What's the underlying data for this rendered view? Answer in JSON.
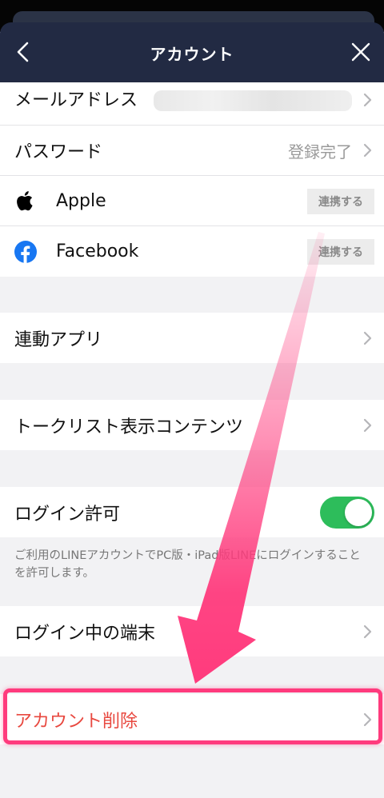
{
  "header": {
    "title": "アカウント"
  },
  "account": {
    "email_label": "メールアドレス",
    "password_label": "パスワード",
    "password_value": "登録完了",
    "apple_label": "Apple",
    "apple_button": "連携する",
    "facebook_label": "Facebook",
    "facebook_button": "連携する"
  },
  "linked_apps": {
    "label": "連動アプリ"
  },
  "talk_list": {
    "label": "トークリスト表示コンテンツ"
  },
  "login_permission": {
    "label": "ログイン許可",
    "enabled": true,
    "note": "ご利用のLINEアカウントでPC版・iPad版LINEにログインすることを許可します。"
  },
  "logged_in_devices": {
    "label": "ログイン中の端末"
  },
  "delete_account": {
    "label": "アカウント削除"
  },
  "colors": {
    "header_bg": "#222a43",
    "toggle_on": "#2dbd5b",
    "danger": "#e8483f",
    "annotation": "#ff3b7d",
    "facebook": "#1877f2"
  }
}
